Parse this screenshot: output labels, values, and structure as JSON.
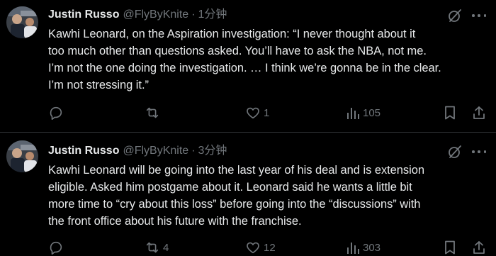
{
  "tweets": [
    {
      "author_name": "Justin Russo",
      "handle": "@FlyByKnite",
      "separator": "·",
      "time": "1分钟",
      "text": "Kawhi Leonard, on the Aspiration investigation: “I never thought about it\ntoo much other than questions asked. You’ll have to ask the NBA, not me.\nI’m not the one doing the investigation. … I think we’re gonna be in the clear.\nI’m not stressing it.”",
      "replies": "",
      "reposts": "",
      "likes": "1",
      "views": "105"
    },
    {
      "author_name": "Justin Russo",
      "handle": "@FlyByKnite",
      "separator": "·",
      "time": "3分钟",
      "text": "Kawhi Leonard will be going into the last year of his deal and is extension\neligible. Asked him postgame about it. Leonard said he wants a little bit\nmore time to “cry about this loss” before going into the “discussions” with\nthe front office about his future with the franchise.",
      "replies": "",
      "reposts": "4",
      "likes": "12",
      "views": "303"
    }
  ],
  "icons": {
    "avatar": "avatar-photo",
    "grok": "grok-icon",
    "more": "more-icon",
    "reply": "reply-icon",
    "repost": "repost-icon",
    "like": "like-icon",
    "views": "views-icon",
    "bookmark": "bookmark-icon",
    "share": "share-icon"
  },
  "colors": {
    "background": "#000000",
    "text": "#e7e9ea",
    "muted": "#71767b",
    "divider": "#2f3336"
  }
}
